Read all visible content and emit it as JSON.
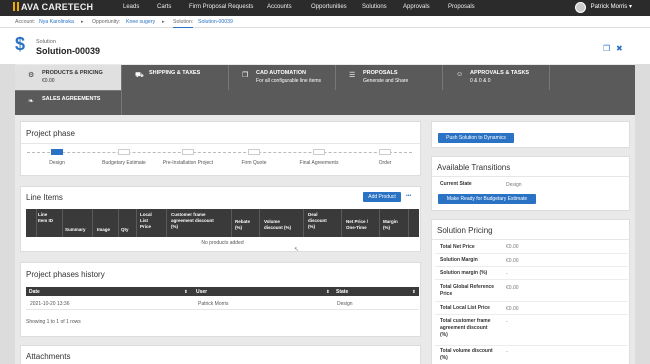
{
  "topbar": {
    "logo": "AVA CARETECH",
    "nav": [
      "Leads",
      "Carts",
      "Firm Proposal Requests",
      "Accounts",
      "Opportunities",
      "Solutions",
      "Approvals",
      "Proposals"
    ],
    "user_name": "Patrick Morris ▾"
  },
  "breadcrumb": {
    "account_label": "Account:",
    "account_value": "Nya Karolinska",
    "opportunity_label": "Opportunity:",
    "opportunity_value": "Knee sugery",
    "solution_label": "Solution:",
    "solution_value": "Solution-00039",
    "sep": "▸"
  },
  "header": {
    "type": "Solution",
    "name": "Solution-00039",
    "icon": "dollar-icon"
  },
  "tabs": [
    {
      "title": "PRODUCTS & PRICING",
      "sub": "€0.00",
      "icon": "gear-icon",
      "glyph": "⚙"
    },
    {
      "title": "SHIPPING & TAXES",
      "sub": "",
      "icon": "truck-icon",
      "glyph": "⛟"
    },
    {
      "title": "CAD AUTOMATION",
      "sub": "For all configurable line items",
      "icon": "document-icon",
      "glyph": "❐"
    },
    {
      "title": "PROPOSALS",
      "sub": "Generate and Share",
      "icon": "proposal-icon",
      "glyph": "☰"
    },
    {
      "title": "APPROVALS & TASKS",
      "sub": "0 & 0 & 0",
      "icon": "person-icon",
      "glyph": "☺"
    },
    {
      "title": "SALES AGREEMENTS",
      "sub": "",
      "icon": "handshake-icon",
      "glyph": "❧"
    }
  ],
  "project_phase": {
    "title": "Project phase",
    "phases": [
      "Design",
      "Budgetary Estimate",
      "Pre-Installation Project",
      "Firm Quote",
      "Final Agreements",
      "Order"
    ]
  },
  "line_items": {
    "title": "Line Items",
    "add_label": "Add Product",
    "more": "•••",
    "columns": [
      [
        "Line",
        "Item ID"
      ],
      [
        "Summary"
      ],
      [
        "Image"
      ],
      [
        "Qty"
      ],
      [
        "Local",
        "List",
        "Price"
      ],
      [
        "Customer frame",
        "agreement discount",
        "(%)"
      ],
      [
        "Rebate",
        "(%)"
      ],
      [
        "Volume",
        "discount (%)"
      ],
      [
        "Deal",
        "discount",
        "(%)"
      ],
      [
        "Net Price /",
        "One-Time"
      ],
      [
        "Margin",
        "(%)"
      ]
    ],
    "empty": "No products added"
  },
  "history": {
    "title": "Project phases history",
    "columns": [
      "Date",
      "User",
      "State"
    ],
    "sort": "⬍",
    "rows": [
      {
        "date": "2021-10-20 13:36",
        "user": "Patrick Morris",
        "state": "Design"
      }
    ],
    "footer": "Showing 1 to 1 of 1 rows"
  },
  "attachments": {
    "title": "Attachments"
  },
  "push_button": "Push Solution to Dynamics",
  "transitions": {
    "title": "Available Transitions",
    "state_label": "Current State",
    "state_value": "Design",
    "button": "Make Ready for Budgetary Estimate"
  },
  "pricing": {
    "title": "Solution Pricing",
    "rows": [
      {
        "label": [
          "Total Net Price"
        ],
        "value": "€0.00"
      },
      {
        "label": [
          "Solution Margin"
        ],
        "value": "€0.00"
      },
      {
        "label": [
          "Solution margin (%)"
        ],
        "value": "-"
      },
      {
        "label": [
          "Total Global Reference",
          "Price"
        ],
        "value": "€0.00"
      },
      {
        "label": [
          "Total Local List Price"
        ],
        "value": "€0.00"
      },
      {
        "label": [
          "Total customer frame",
          "agreement discount",
          "(%)"
        ],
        "value": "-"
      },
      {
        "label": [
          "Total volume discount",
          "(%)"
        ],
        "value": "-"
      }
    ]
  },
  "colors": {
    "accent": "#2a72c4",
    "topbar": "#2b2b2b",
    "tabbar": "#5a5a5a",
    "brand": "#f2a900"
  }
}
